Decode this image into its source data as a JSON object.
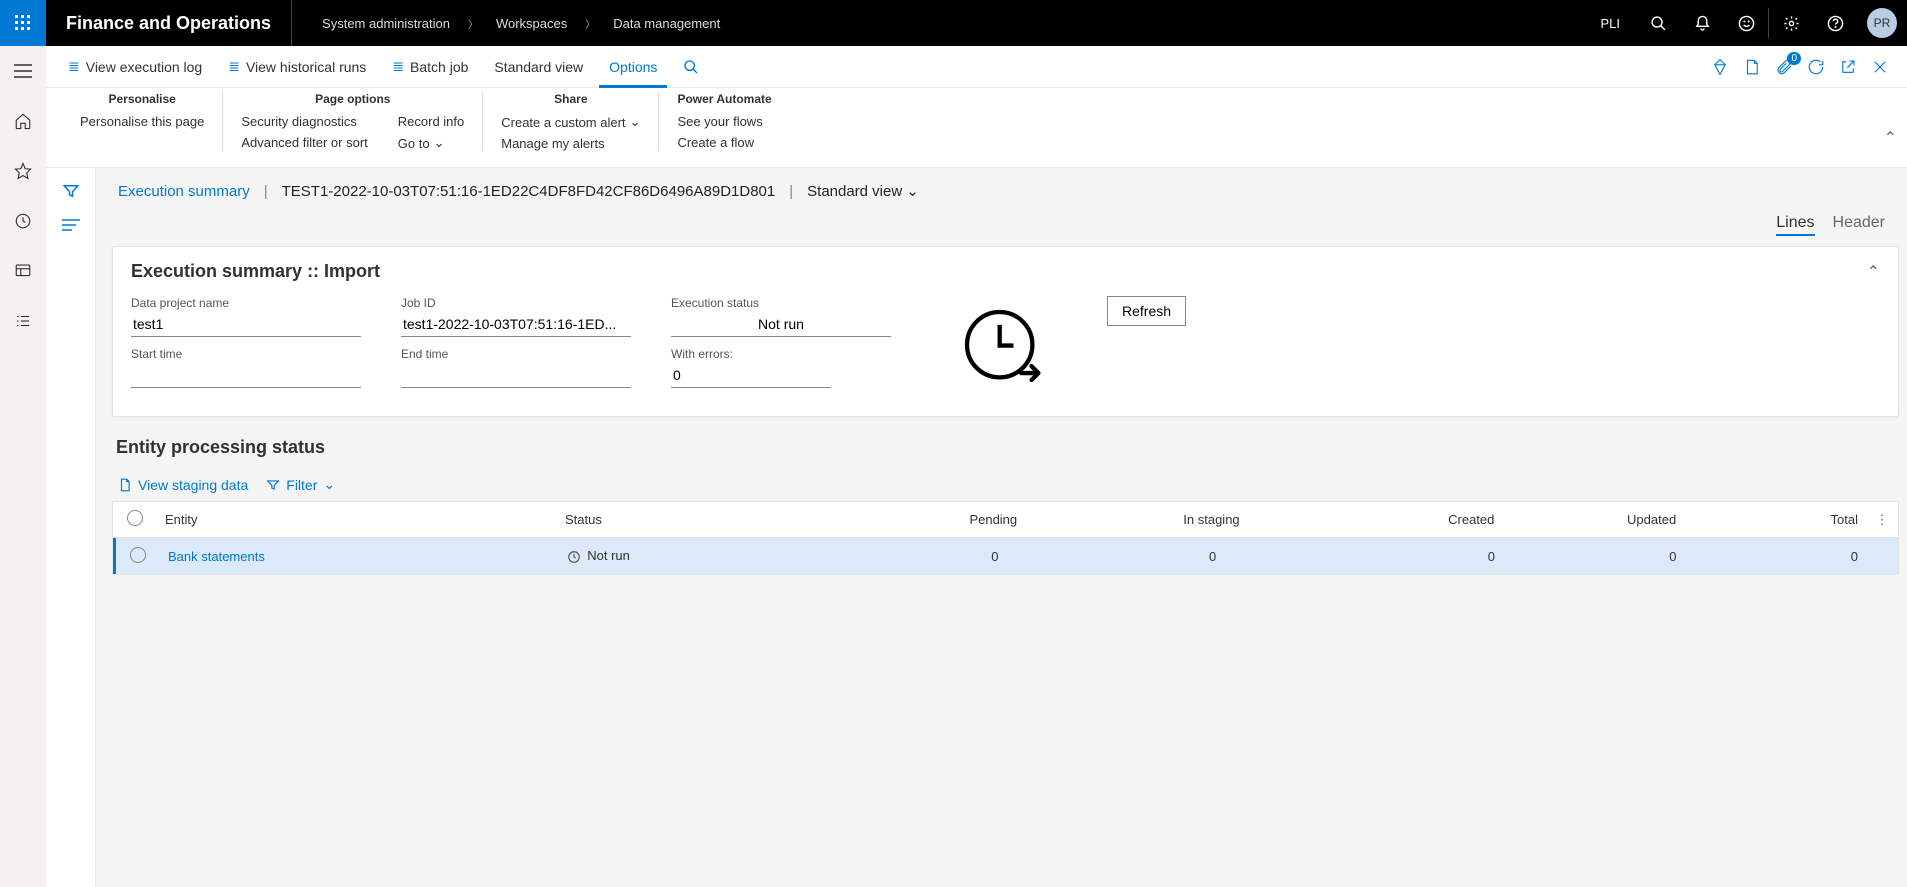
{
  "header": {
    "appTitle": "Finance and Operations",
    "breadcrumb": [
      "System administration",
      "Workspaces",
      "Data management"
    ],
    "env": "PLI",
    "userInitials": "PR"
  },
  "actionbar": {
    "viewExecLog": "View execution log",
    "viewHistRuns": "View historical runs",
    "batchJob": "Batch job",
    "standardView": "Standard view",
    "options": "Options",
    "attachBadge": "0"
  },
  "ribbon": {
    "personalise": {
      "title": "Personalise",
      "personalisePage": "Personalise this page"
    },
    "pageOptions": {
      "title": "Page options",
      "secDiag": "Security diagnostics",
      "advFilter": "Advanced filter or sort",
      "recordInfo": "Record info",
      "goTo": "Go to"
    },
    "share": {
      "title": "Share",
      "createAlert": "Create a custom alert",
      "manageAlerts": "Manage my alerts"
    },
    "powerAutomate": {
      "title": "Power Automate",
      "seeFlows": "See your flows",
      "createFlow": "Create a flow"
    }
  },
  "page": {
    "titleLink": "Execution summary",
    "jobIdFull": "TEST1-2022-10-03T07:51:16-1ED22C4DF8FD42CF86D6496A89D1D801",
    "viewSelector": "Standard view",
    "tabs": {
      "lines": "Lines",
      "header": "Header"
    }
  },
  "summary": {
    "panelTitle": "Execution summary :: Import",
    "labels": {
      "dataProjectName": "Data project name",
      "jobId": "Job ID",
      "execStatus": "Execution status",
      "startTime": "Start time",
      "endTime": "End time",
      "withErrors": "With errors:"
    },
    "values": {
      "dataProjectName": "test1",
      "jobId": "test1-2022-10-03T07:51:16-1ED...",
      "execStatus": "Not run",
      "startTime": "",
      "endTime": "",
      "withErrors": "0"
    },
    "refresh": "Refresh"
  },
  "entity": {
    "title": "Entity processing status",
    "viewStaging": "View staging data",
    "filter": "Filter",
    "columns": {
      "entity": "Entity",
      "status": "Status",
      "pending": "Pending",
      "inStaging": "In staging",
      "created": "Created",
      "updated": "Updated",
      "total": "Total"
    },
    "rows": [
      {
        "entity": "Bank statements",
        "status": "Not run",
        "pending": "0",
        "inStaging": "0",
        "created": "0",
        "updated": "0",
        "total": "0"
      }
    ]
  }
}
